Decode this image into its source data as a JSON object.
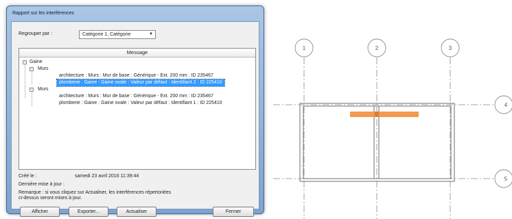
{
  "dialog": {
    "title": "Rapport sur les interférences",
    "group_label": "Regrouper par :",
    "group_value": "Catégorie 1, Catégorie",
    "column_header": "Message",
    "tree": {
      "root": "Gaine",
      "group1": "Murs",
      "group1_item1": "architecture : Murs : Mur de base : Générique - Ext. 200 mm : ID 235467",
      "group1_item2": "plomberie : Gaine : Gaine ovale : Valeur par défaut : Identifiant 2 : ID 225410",
      "group2": "Murs",
      "group2_item1": "architecture : Murs : Mur de base : Générique - Ext. 200 mm : ID 235467",
      "group2_item2": "plomberie : Gaine : Gaine ovale : Valeur par défaut : Identifiant 1 : ID 225410"
    },
    "created_label": "Créé le :",
    "created_value": "samedi 23 avril 2016 11:39:44",
    "last_update_label": "Dernière mise à jour :",
    "remark_line1": "Remarque : si vous cliquez sur Actualiser, les interférences répertoriées",
    "remark_line2": "ci-dessus seront mises à jour.",
    "buttons": {
      "show": "Afficher",
      "export": "Exporter...",
      "refresh": "Actualiser",
      "close": "Fermer"
    }
  },
  "drawing": {
    "grid_labels": [
      "1",
      "2",
      "3",
      "4",
      "5"
    ],
    "clash_color": "#f39a4f",
    "wall_color": "#7a7a7a"
  }
}
